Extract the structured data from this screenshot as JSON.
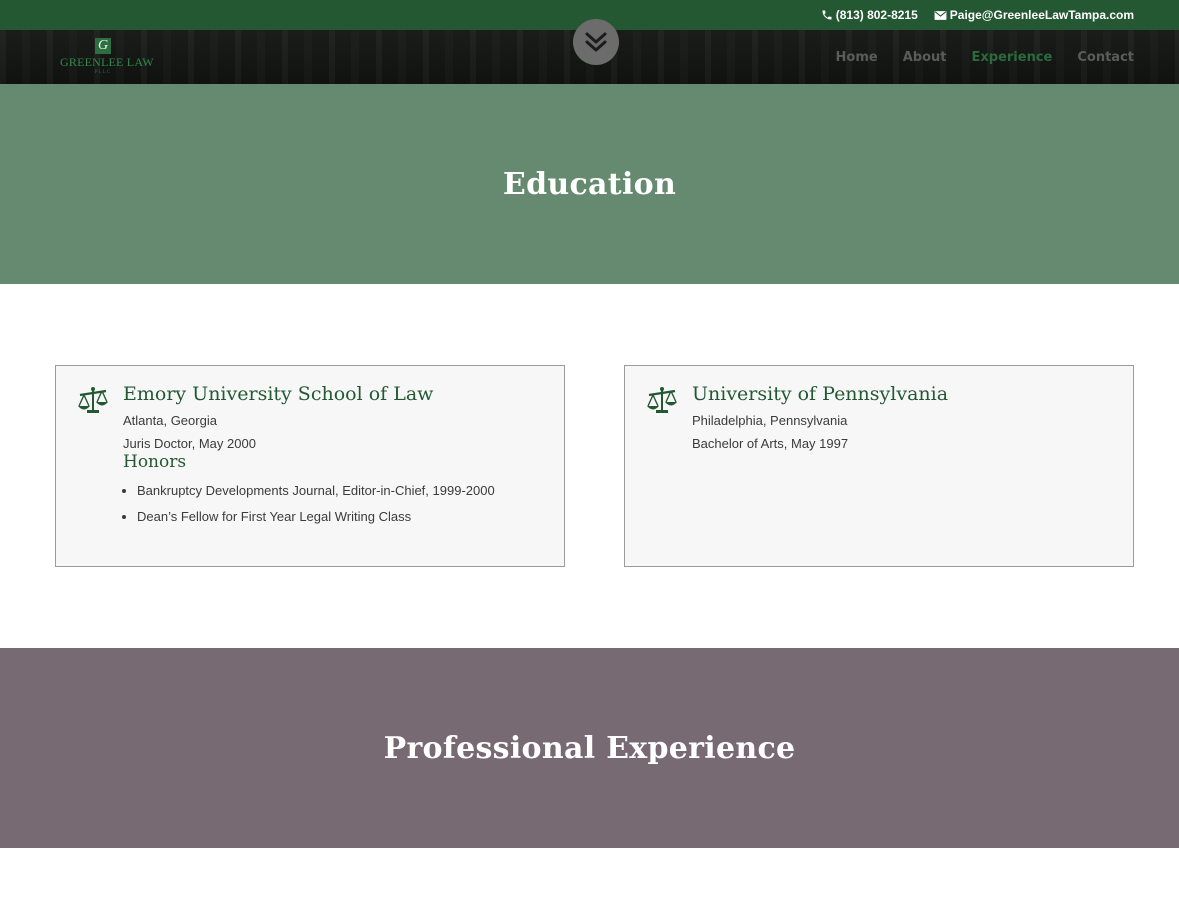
{
  "topbar": {
    "phone": "(813) 802-8215",
    "email": "Paige@GreenleeLawTampa.com"
  },
  "logo": {
    "mark": "G",
    "name": "GREENLEE LAW",
    "sub": "PLLC"
  },
  "nav": {
    "items": [
      {
        "label": "Home"
      },
      {
        "label": "About"
      },
      {
        "label": "Experience"
      },
      {
        "label": "Contact"
      }
    ],
    "active": "Experience"
  },
  "education": {
    "title": "Education",
    "cards": [
      {
        "school": "Emory University School of Law",
        "location": "Atlanta, Georgia",
        "degree": "Juris Doctor, May 2000",
        "honors_heading": "Honors",
        "honors": [
          "Bankruptcy Developments Journal, Editor-in-Chief, 1999-2000",
          "Dean’s Fellow for First Year Legal Writing Class"
        ]
      },
      {
        "school": "University of Pennsylvania",
        "location": "Philadelphia, Pennsylvania",
        "degree": "Bachelor of Arts, May 1997"
      }
    ]
  },
  "professional": {
    "title": "Professional Experience"
  },
  "colors": {
    "brand_green": "#235833",
    "education_band": "#658a70",
    "professional_band": "#776a73"
  },
  "icons": {
    "phone": "phone-icon",
    "email": "envelope-icon",
    "scroll": "double-chevron-down-icon",
    "card": "scales-of-justice-icon"
  }
}
